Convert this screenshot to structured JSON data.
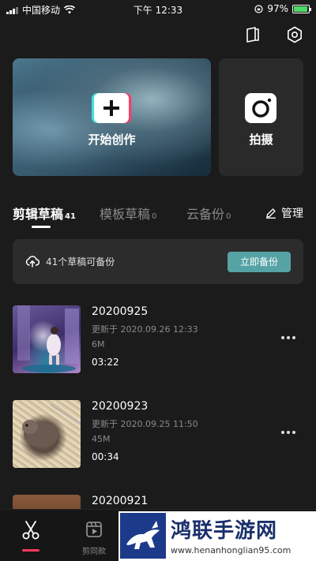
{
  "status_bar": {
    "carrier": "中国移动",
    "time": "下午 12:33",
    "battery": "97%",
    "battery_level": 0.97,
    "icons": [
      "signal-icon",
      "wifi-icon",
      "orientation-lock-icon",
      "battery-icon"
    ]
  },
  "top_icons": [
    "book-icon",
    "settings-icon"
  ],
  "hero": {
    "create_label": "开始创作",
    "shoot_label": "拍摄"
  },
  "tabs": [
    {
      "label": "剪辑草稿",
      "count": "41",
      "active": true
    },
    {
      "label": "模板草稿",
      "count": "0",
      "active": false
    },
    {
      "label": "云备份",
      "count": "0",
      "active": false
    }
  ],
  "manage_label": "管理",
  "backup": {
    "text": "41个草稿可备份",
    "button": "立即备份"
  },
  "drafts": [
    {
      "title": "20200925",
      "updated": "更新于 2020.09.26 12:33",
      "size": "6M",
      "duration": "03:22"
    },
    {
      "title": "20200923",
      "updated": "更新于 2020.09.25 11:50",
      "size": "45M",
      "duration": "00:34"
    },
    {
      "title": "20200921"
    }
  ],
  "bottom_nav": {
    "template_label": "剪同款"
  },
  "watermark": {
    "title": "鸿联手游网",
    "url": "www.henanhonglian95.com"
  },
  "colors": {
    "background": "#1b1b1b",
    "accent_teal": "#56a3a6",
    "active_red": "#ff3a5a"
  }
}
